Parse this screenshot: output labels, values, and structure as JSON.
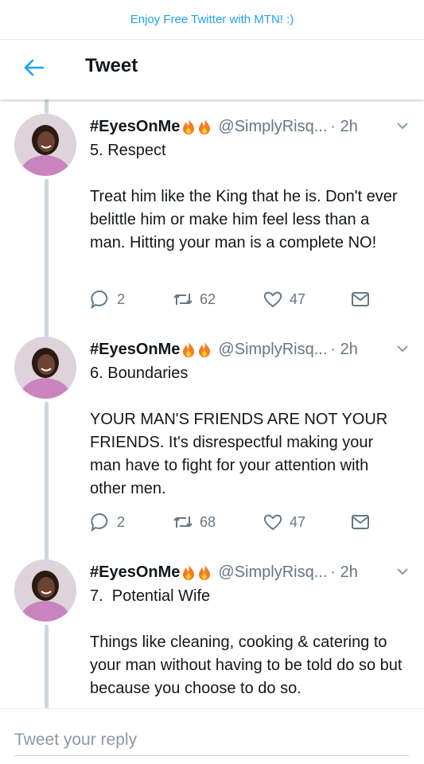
{
  "banner": {
    "text": "Enjoy Free Twitter with MTN! :)"
  },
  "header": {
    "title": "Tweet",
    "back_icon": "arrow-left-icon"
  },
  "tweets": [
    {
      "name": "#EyesOnMe",
      "handle": "@SimplyRisq...",
      "time": "· 2h",
      "body": "5. Respect\n\nTreat him like the King that he is. Don't ever belittle him or make him feel less than a man. Hitting your man is a complete NO!",
      "replies": "2",
      "retweets": "62",
      "likes": "47"
    },
    {
      "name": "#EyesOnMe",
      "handle": "@SimplyRisq...",
      "time": "· 2h",
      "body": "6. Boundaries\n\nYOUR MAN'S FRIENDS ARE NOT YOUR FRIENDS. It's disrespectful making your man have to fight for your attention with other men.",
      "replies": "2",
      "retweets": "68",
      "likes": "47"
    },
    {
      "name": "#EyesOnMe",
      "handle": "@SimplyRisq...",
      "time": "· 2h",
      "body": "7.  Potential Wife\n\nThings like cleaning, cooking & catering to your man without having to be told do so but because you choose to do so."
    }
  ],
  "reply": {
    "placeholder": "Tweet your reply"
  },
  "colors": {
    "accent": "#1da1f2",
    "secondary_text": "#657786",
    "thread_line": "#ccd6dd"
  }
}
